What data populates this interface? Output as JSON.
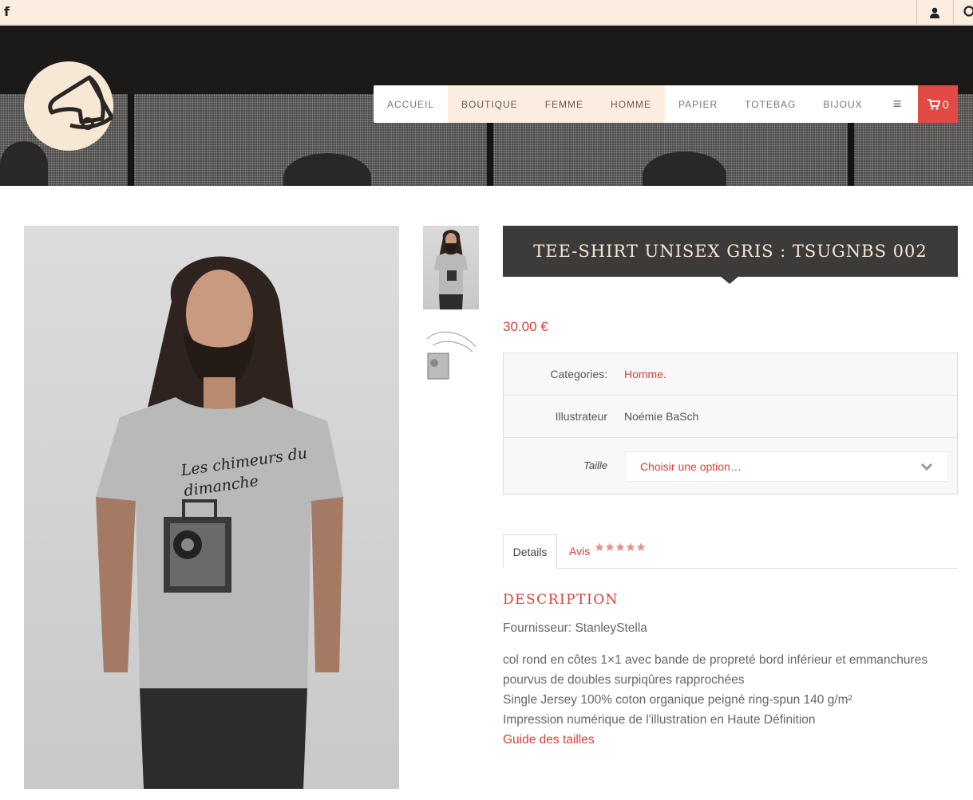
{
  "topbar": {
    "facebook_label": "f"
  },
  "nav": {
    "items": [
      {
        "label": "ACCUEIL",
        "highlight": false
      },
      {
        "label": "BOUTIQUE",
        "highlight": true
      },
      {
        "label": "FEMME",
        "highlight": true
      },
      {
        "label": "HOMME",
        "highlight": true
      },
      {
        "label": "PAPIER",
        "highlight": false
      },
      {
        "label": "TOTEBAG",
        "highlight": false
      },
      {
        "label": "BIJOUX",
        "highlight": false
      }
    ],
    "menu_icon": "≡",
    "cart_count": "0"
  },
  "product": {
    "title": "TEE-SHIRT UNISEX GRIS : TSUGNBS 002",
    "price": "30.00 €",
    "categories_label": "Categories:",
    "categories_value": "Homme.",
    "illustrateur_label": "Illustrateur",
    "illustrateur_value": "Noémie BaSch",
    "taille_label": "Taille",
    "taille_select": "Choisir une option…",
    "print_text": "Les chimeurs du dimanche"
  },
  "tabs": {
    "details": "Details",
    "avis": "Avis",
    "rating": 5
  },
  "description": {
    "heading": "DESCRIPTION",
    "supplier": "Fournisseur: StanleyStella",
    "line1": "col rond en côtes 1×1 avec bande de propreté bord inférieur et emmanchures",
    "line2": "pourvus de doubles surpiqûres rapprochées",
    "line3": "Single Jersey 100% coton organique peigné ring-spun 140 g/m²",
    "line4": "Impression numérique de l'illustration en Haute Définition",
    "size_guide": "Guide des tailles"
  },
  "colors": {
    "accent": "#d9403a",
    "cream": "#fbeee0",
    "dark": "#3d3b3a"
  }
}
